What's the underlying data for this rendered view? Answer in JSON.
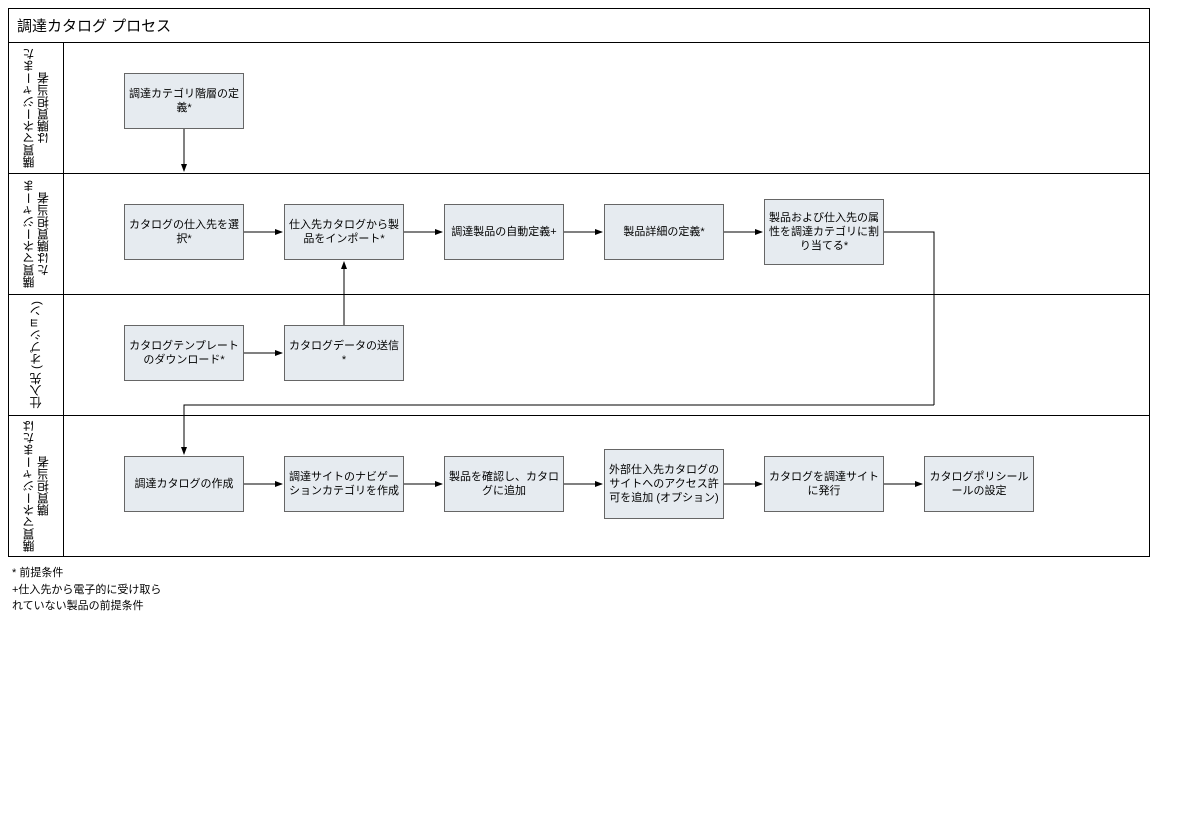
{
  "title": "調達カタログ プロセス",
  "lanes": {
    "lane1": {
      "label": "購買マネージャーまたは購買担当者"
    },
    "lane2": {
      "label": "購買マネージャーまたは購買担当者"
    },
    "lane3": {
      "label": "仕入先 (オプション)"
    },
    "lane4": {
      "label": "購買マネージャーまたは購買担当者"
    }
  },
  "boxes": {
    "b1": "調達カテゴリ階層の定義*",
    "b2": "カタログの仕入先を選択*",
    "b3": "仕入先カタログから製品をインポート*",
    "b4": "調達製品の自動定義+",
    "b5": "製品詳細の定義*",
    "b6": "製品および仕入先の属性を調達カテゴリに割り当てる*",
    "b7": "カタログテンプレートのダウンロード*",
    "b8": "カタログデータの送信*",
    "b9": "調達カタログの作成",
    "b10": "調達サイトのナビゲーションカテゴリを作成",
    "b11": "製品を確認し、カタログに追加",
    "b12": "外部仕入先カタログのサイトへのアクセス許可を追加 (オプション)",
    "b13": "カタログを調達サイトに発行",
    "b14": "カタログポリシールールの設定"
  },
  "footnotes": {
    "f1": "* 前提条件",
    "f2": "+仕入先から電子的に受け取られていない製品の前提条件"
  }
}
